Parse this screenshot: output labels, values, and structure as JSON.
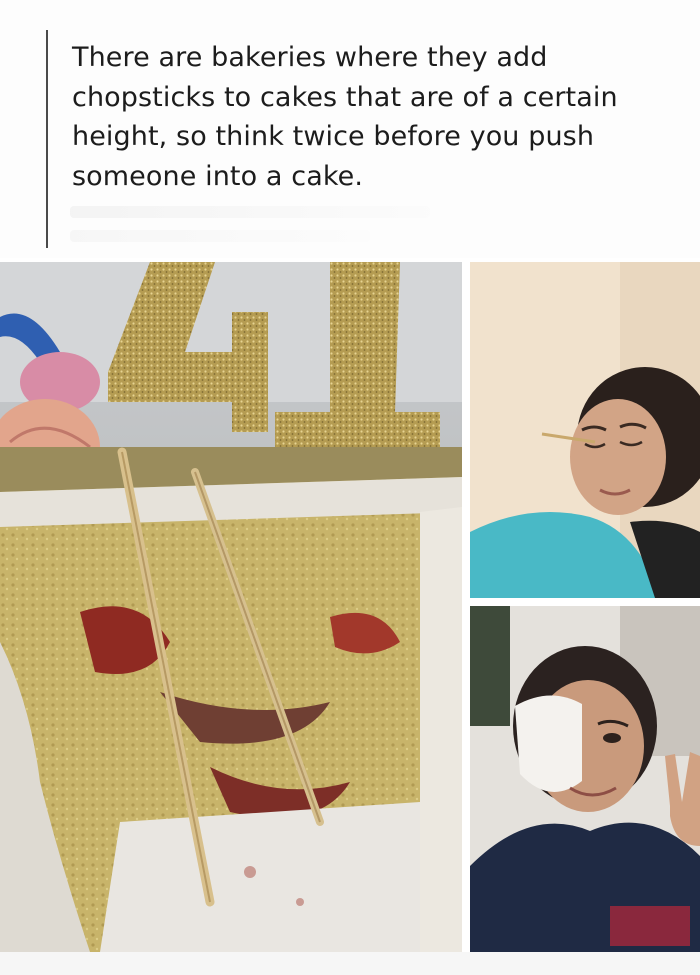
{
  "post": {
    "text": "There are bakeries where they add chopsticks to cakes that are of a certain height, so think twice before you push someone into a cake."
  },
  "photos": {
    "cake": {
      "subject": "cut-cake-with-chopsticks"
    },
    "woman_top": {
      "subject": "woman-with-chopstick-near-eye"
    },
    "woman_bottom": {
      "subject": "woman-with-eye-bandage"
    }
  },
  "colors": {
    "glitter_gold": "#b9a056",
    "sponge": "#c9b66a",
    "frosting": "#ece8e0",
    "jam": "#9b2a20",
    "wall": "#f2e3cf",
    "scrubs": "#49b9c6",
    "hoodie": "#1f2a44"
  }
}
